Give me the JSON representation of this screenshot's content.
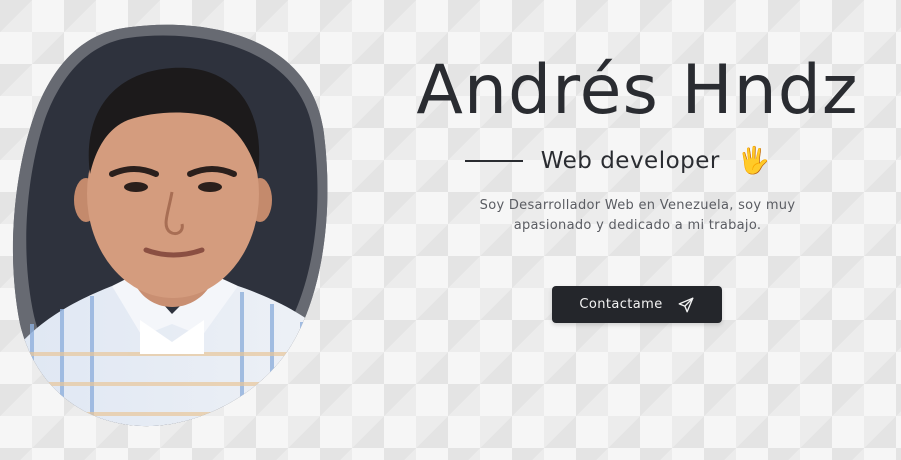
{
  "profile": {
    "name": "Andrés Hndz",
    "role": "Web developer",
    "role_icon": "waving-hand-icon",
    "description": "Soy Desarrollador Web en Venezuela, soy muy apasionado y dedicado a mi trabajo.",
    "photo_icon": "profile-photo"
  },
  "cta": {
    "label": "Contactame",
    "icon": "send-icon"
  },
  "colors": {
    "background": "#ececec",
    "blob_dark": "#2e323d",
    "blob_border": "#676a72",
    "text": "#2a2c31",
    "button": "#24262b"
  }
}
